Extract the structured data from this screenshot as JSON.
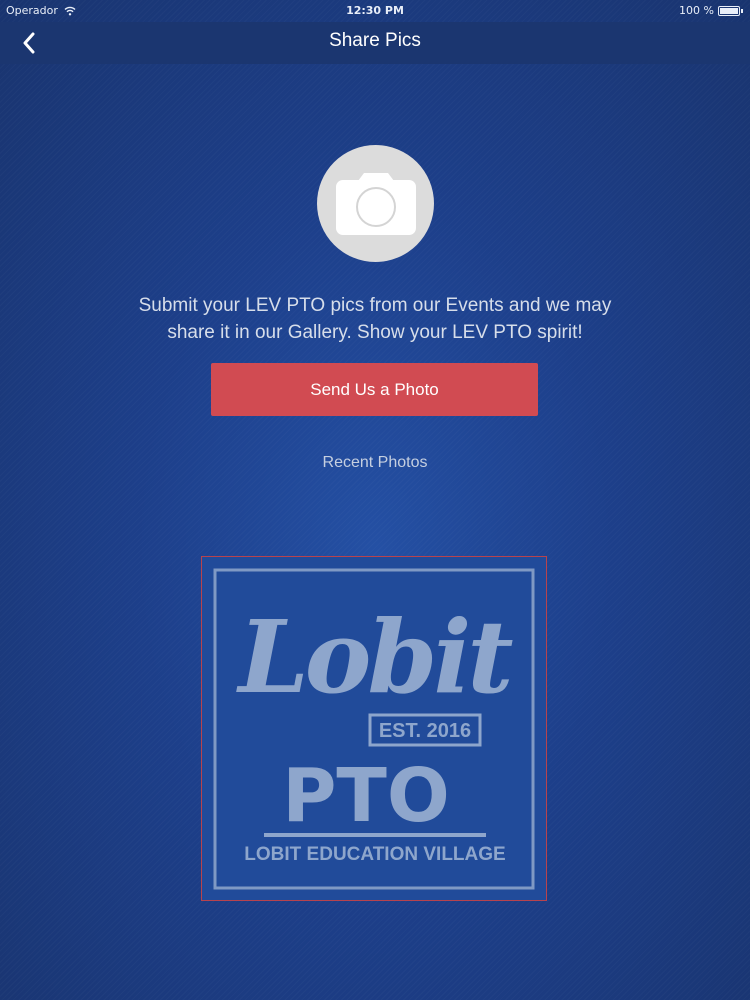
{
  "status_bar": {
    "carrier": "Operador",
    "time": "12:30 PM",
    "battery": "100 %"
  },
  "nav": {
    "title": "Share Pics",
    "back_icon": "chevron-left-icon"
  },
  "main": {
    "camera_icon": "camera-icon",
    "intro_line_1": "Submit your LEV PTO pics from our Events and we may",
    "intro_line_2": "share it in our Gallery. Show your LEV PTO spirit!",
    "send_button_label": "Send Us a Photo",
    "recent_label": "Recent Photos"
  },
  "recent_photos": [
    {
      "logo_word": "Lobit",
      "est_text": "EST. 2016",
      "pto_text": "PTO",
      "school_text": "LOBIT EDUCATION VILLAGE"
    }
  ],
  "colors": {
    "background": "#1d3f8a",
    "nav_bar": "#1b3670",
    "button": "#d14b52",
    "camera_circle": "#dcdcdc",
    "logo_text": "#8ea6cc"
  }
}
